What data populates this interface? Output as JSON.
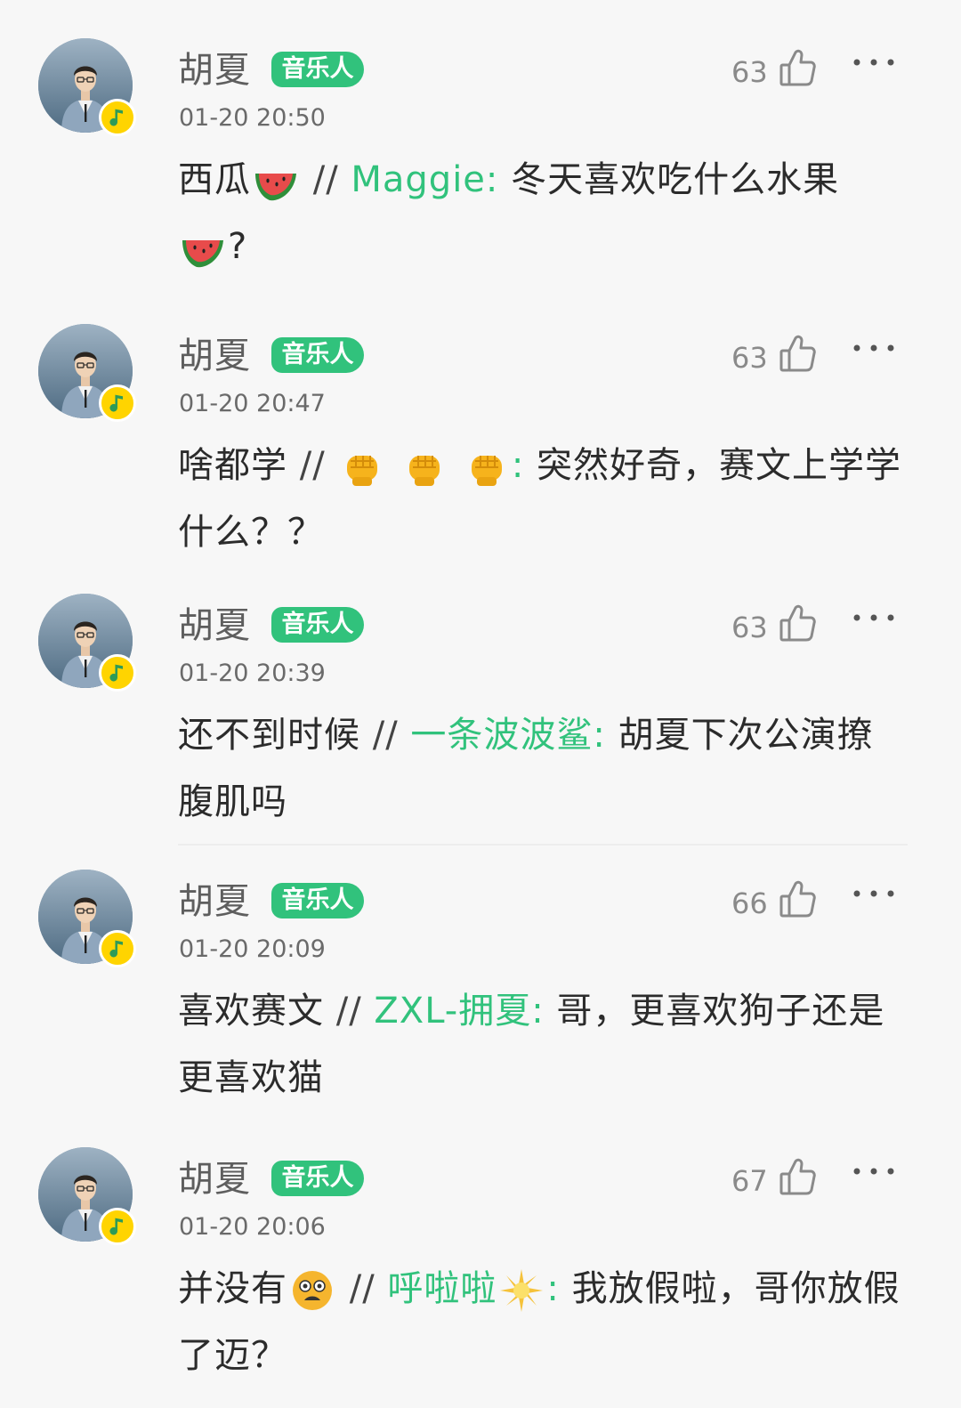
{
  "comments": [
    {
      "username": "胡夏",
      "badge": "音乐人",
      "time": "01-20 20:50",
      "likes": "63",
      "reply": "西瓜",
      "reply_emoji": "watermelon-icon",
      "sep": " // ",
      "quoted_user": "Maggie",
      "colon": ": ",
      "quoted_text": "冬天喜欢吃什么水果",
      "tail_emoji": "watermelon-icon",
      "tail": "?"
    },
    {
      "username": "胡夏",
      "badge": "音乐人",
      "time": "01-20 20:47",
      "likes": "63",
      "reply": "啥都学",
      "sep": " // ",
      "quoted_user_emojis": [
        "fist-icon",
        "fist-icon",
        "fist-icon"
      ],
      "colon": ": ",
      "quoted_text": "突然好奇，赛文上学学什么？？"
    },
    {
      "username": "胡夏",
      "badge": "音乐人",
      "time": "01-20 20:39",
      "likes": "63",
      "reply": "还不到时候",
      "sep": " // ",
      "quoted_user": "一条波波鲨",
      "colon": ": ",
      "quoted_text": "胡夏下次公演撩腹肌吗"
    },
    {
      "username": "胡夏",
      "badge": "音乐人",
      "time": "01-20 20:09",
      "likes": "66",
      "reply": "喜欢赛文",
      "sep": " // ",
      "quoted_user": "ZXL-拥夏",
      "colon": ": ",
      "quoted_text": "哥，更喜欢狗子还是更喜欢猫"
    },
    {
      "username": "胡夏",
      "badge": "音乐人",
      "time": "01-20 20:06",
      "likes": "67",
      "reply": "并没有",
      "reply_emoji": "dizzy-face-icon",
      "sep": " // ",
      "quoted_user": "呼啦啦",
      "quoted_user_emoji": "sparkle-sun-icon",
      "colon": ": ",
      "quoted_text": "我放假啦，哥你放假了迈？"
    }
  ],
  "colors": {
    "accent_green": "#31c27c",
    "badge_yellow": "#ffd400",
    "background": "#f7f7f7"
  }
}
